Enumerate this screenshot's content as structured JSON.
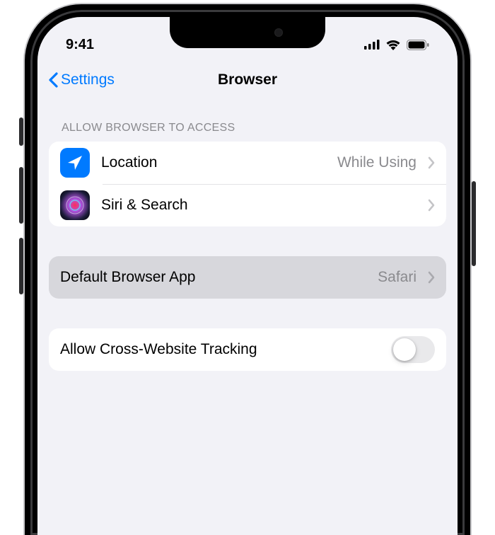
{
  "status": {
    "time": "9:41"
  },
  "nav": {
    "back_label": "Settings",
    "title": "Browser"
  },
  "section1": {
    "header": "ALLOW BROWSER TO ACCESS",
    "location": {
      "label": "Location",
      "value": "While Using"
    },
    "siri": {
      "label": "Siri & Search"
    }
  },
  "section2": {
    "default": {
      "label": "Default Browser App",
      "value": "Safari"
    }
  },
  "section3": {
    "tracking": {
      "label": "Allow Cross-Website Tracking"
    }
  }
}
